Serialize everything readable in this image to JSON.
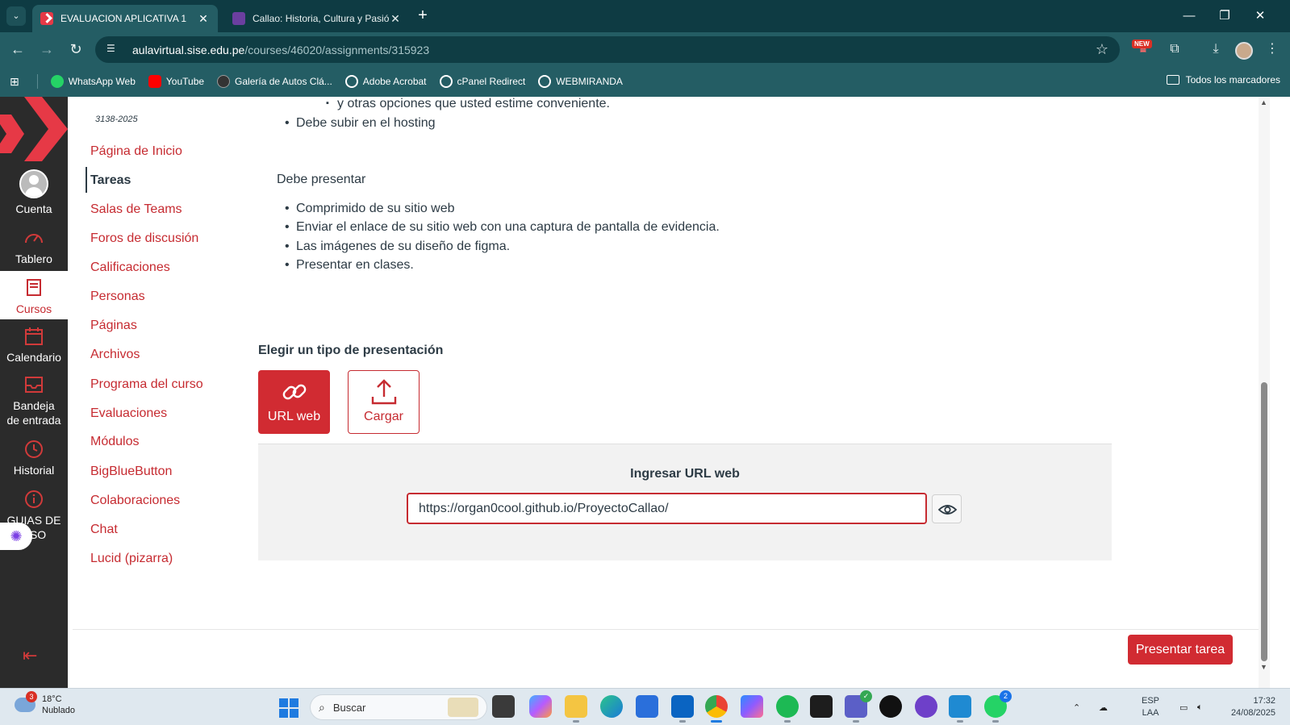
{
  "browser": {
    "tabs": [
      {
        "title": "EVALUACION APLICATIVA 1",
        "active": true
      },
      {
        "title": "Callao: Historia, Cultura y Pasión",
        "active": false
      }
    ],
    "url_host": "aulavirtual.sise.edu.pe",
    "url_path": "/courses/46020/assignments/315923",
    "new_badge": "NEW",
    "bookmarks": [
      {
        "label": "WhatsApp Web",
        "color": "#25d366"
      },
      {
        "label": "YouTube",
        "color": "#ff0000"
      },
      {
        "label": "Galería de Autos Clá...",
        "color": "#333333"
      },
      {
        "label": "Adobe Acrobat",
        "color": "#ffffff"
      },
      {
        "label": "cPanel Redirect",
        "color": "#ffffff"
      },
      {
        "label": "WEBMIRANDA",
        "color": "#ffffff"
      }
    ],
    "all_bookmarks": "Todos los marcadores"
  },
  "global_nav": {
    "items": [
      {
        "label": "Cuenta",
        "icon": "account-avatar-icon"
      },
      {
        "label": "Tablero",
        "icon": "dashboard-gauge-icon"
      },
      {
        "label": "Cursos",
        "icon": "courses-book-icon"
      },
      {
        "label": "Calendario",
        "icon": "calendar-icon"
      },
      {
        "label": "Bandeja de entrada",
        "icon": "inbox-icon"
      },
      {
        "label": "Historial",
        "icon": "history-clock-icon"
      },
      {
        "label": "GUIAS DE USO",
        "icon": "info-icon"
      }
    ]
  },
  "course_nav": {
    "term": "3138-2025",
    "links": [
      "Página de Inicio",
      "Tareas",
      "Salas de Teams",
      "Foros de discusión",
      "Calificaciones",
      "Personas",
      "Páginas",
      "Archivos",
      "Programa del curso",
      "Evaluaciones",
      "Módulos",
      "BigBlueButton",
      "Colaboraciones",
      "Chat",
      "Lucid (pizarra)"
    ],
    "active_index": 1
  },
  "assignment": {
    "sub_bullet": "y otras opciones que usted estime conveniente.",
    "hosting_bullet": "Debe subir en el hosting",
    "present_heading": "Debe presentar",
    "present_items": [
      "Comprimido de su sitio web",
      "Enviar el enlace de su sitio web con una captura de pantalla de evidencia.",
      "Las imágenes de su diseño de figma.",
      "Presentar en clases."
    ]
  },
  "submission": {
    "choose_type": "Elegir un tipo de presentación",
    "type_url": "URL web",
    "type_upload": "Cargar",
    "url_title": "Ingresar URL web",
    "url_value": "https://organ0cool.github.io/ProyectoCallao/",
    "submit_label": "Presentar tarea"
  },
  "taskbar": {
    "weather_temp": "18°C",
    "weather_desc": "Nublado",
    "weather_badge": "3",
    "search_placeholder": "Buscar",
    "teams_badge": "",
    "whatsapp_badge": "2",
    "lang_top": "ESP",
    "lang_bottom": "LAA",
    "time": "17:32",
    "date": "24/08/2025"
  },
  "colors": {
    "brand_red": "#d12b32",
    "link_red": "#c62b31",
    "chrome_teal": "#245d64",
    "nav_dark": "#2b2b2b"
  }
}
